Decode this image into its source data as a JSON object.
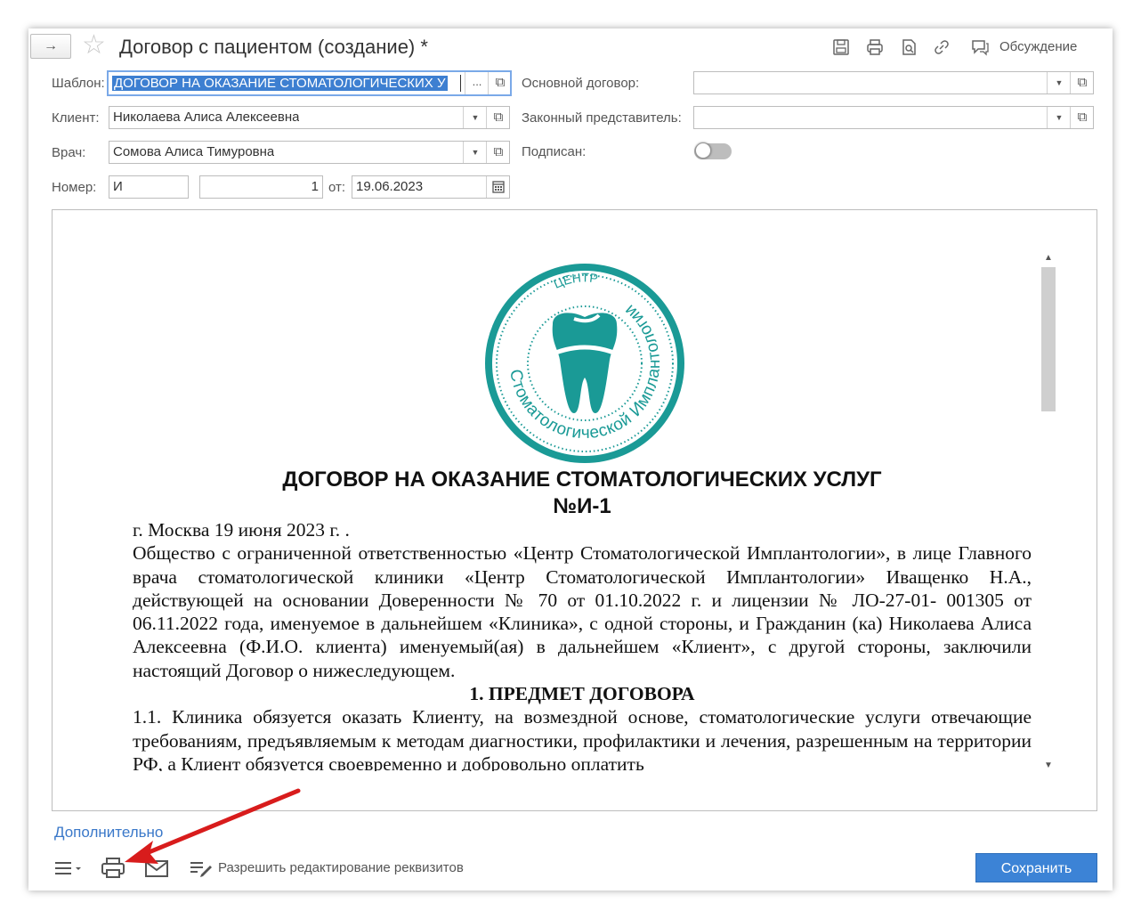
{
  "window": {
    "title": "Договор с пациентом (создание) *",
    "nav_arrow": "→",
    "discuss_label": "Обсуждение"
  },
  "form": {
    "template_label": "Шаблон:",
    "template_value": "ДОГОВОР НА ОКАЗАНИЕ СТОМАТОЛОГИЧЕСКИХ У",
    "template_more": "...",
    "client_label": "Клиент:",
    "client_value": "Николаева Алиса Алексеевна",
    "doctor_label": "Врач:",
    "doctor_value": "Сомова Алиса Тимуровна",
    "number_label": "Номер:",
    "number_prefix": "И",
    "number_value": "1",
    "date_label": "от:",
    "date_value": "19.06.2023",
    "main_contract_label": "Основной договор:",
    "main_contract_value": "",
    "legal_rep_label": "Законный представитель:",
    "legal_rep_value": "",
    "signed_label": "Подписан:",
    "signed": false
  },
  "document": {
    "logo_text_top": "ЦЕНТР",
    "logo_text_ring": "Стоматологической Имплантологии",
    "title_line1": "ДОГОВОР НА ОКАЗАНИЕ СТОМАТОЛОГИЧЕСКИХ УСЛУГ",
    "title_line2": "№И-1",
    "line_city": "г. Москва 19 июня 2023 г. .",
    "para_intro": "Общество с ограниченной ответственностью «Центр Стоматологической Имплантологии», в лице Главного врача стоматологической клиники «Центр Стоматологической Имплантологии» Иващенко Н.А., действующей на основании Доверенности № 70 от 01.10.2022 г. и лицензии № ЛО-27-01- 001305 от 06.11.2022 года, именуемое в дальнейшем «Клиника», с одной стороны, и Гражданин (ка) Николаева Алиса Алексеевна (Ф.И.О. клиента) именуемый(ая) в дальнейшем «Клиент», с другой стороны, заключили настоящий Договор о нижеследующем.",
    "section1_heading": "1. ПРЕДМЕТ ДОГОВОРА",
    "para_1_1": "1.1. Клиника обязуется оказать Клиенту, на возмездной основе, стоматологические услуги отвечающие требованиям, предъявляемым к методам диагностики, профилактики и лечения, разрешенным на территории РФ, а Клиент обязуется своевременно и добровольно оплатить"
  },
  "footer": {
    "more_link": "Дополнительно",
    "allow_edit_label": "Разрешить редактирование реквизитов",
    "save_label": "Сохранить"
  },
  "colors": {
    "accent": "#3c83d6",
    "logo_teal": "#1a9a96",
    "annotation_arrow": "#d81c1c"
  }
}
